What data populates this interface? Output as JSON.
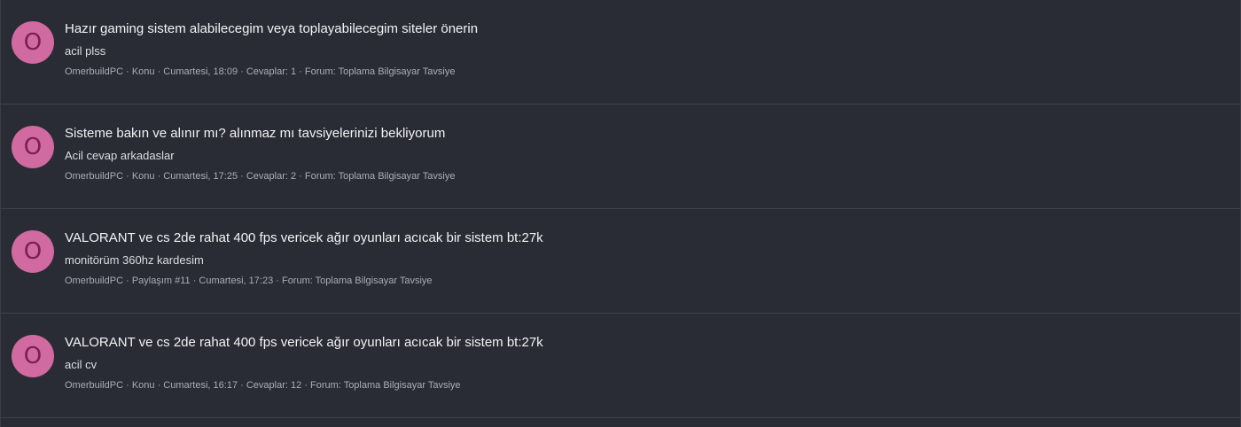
{
  "colors": {
    "background": "#2a2c35",
    "divider": "#3f424c",
    "avatar_bg": "#d06aa1",
    "avatar_text": "#7a1f4f"
  },
  "results": [
    {
      "avatar_letter": "O",
      "title": "Hazır gaming sistem alabilecegim veya toplayabilecegim siteler önerin",
      "snippet": "acil plss",
      "author": "OmerbuildPC",
      "type": "Konu",
      "date": "Cumartesi, 18:09",
      "replies": "Cevaplar: 1",
      "forum": "Forum: Toplama Bilgisayar Tavsiye"
    },
    {
      "avatar_letter": "O",
      "title": "Sisteme bakın ve alınır mı? alınmaz mı tavsiyelerinizi bekliyorum",
      "snippet": "Acil cevap arkadaslar",
      "author": "OmerbuildPC",
      "type": "Konu",
      "date": "Cumartesi, 17:25",
      "replies": "Cevaplar: 2",
      "forum": "Forum: Toplama Bilgisayar Tavsiye"
    },
    {
      "avatar_letter": "O",
      "title": "VALORANT ve cs 2de rahat 400 fps vericek ağır oyunları acıcak bir sistem bt:27k",
      "snippet": "monitörüm 360hz kardesim",
      "author": "OmerbuildPC",
      "type": "Paylaşım #11",
      "date": "Cumartesi, 17:23",
      "replies": "",
      "forum": "Forum: Toplama Bilgisayar Tavsiye"
    },
    {
      "avatar_letter": "O",
      "title": "VALORANT ve cs 2de rahat 400 fps vericek ağır oyunları acıcak bir sistem bt:27k",
      "snippet": "acil cv",
      "author": "OmerbuildPC",
      "type": "Konu",
      "date": "Cumartesi, 16:17",
      "replies": "Cevaplar: 12",
      "forum": "Forum: Toplama Bilgisayar Tavsiye"
    }
  ]
}
